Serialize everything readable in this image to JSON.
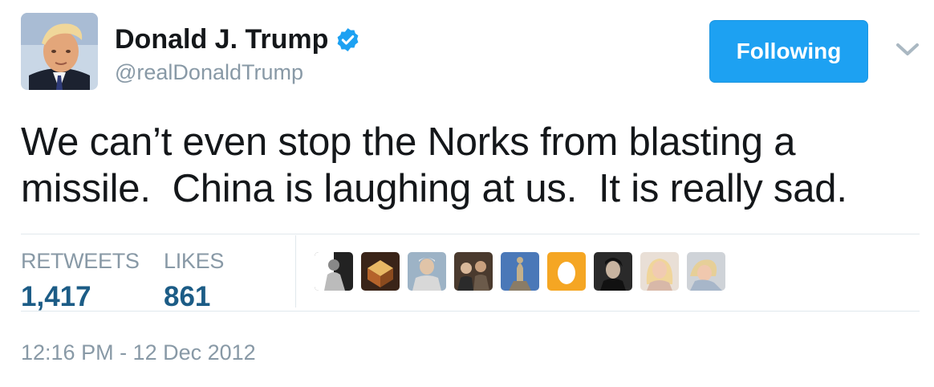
{
  "user": {
    "display_name": "Donald J. Trump",
    "handle": "@realDonaldTrump",
    "verified": true
  },
  "follow_button": {
    "label": "Following"
  },
  "tweet": {
    "text": "We can’t even stop the Norks from blasting a\nmissile.  China is laughing at us.  It is really sad."
  },
  "stats": {
    "retweets_label": "RETWEETS",
    "retweets_value": "1,417",
    "likes_label": "LIKES",
    "likes_value": "861"
  },
  "likers": [
    {
      "icon": "statue-portrait"
    },
    {
      "icon": "lamp-portrait"
    },
    {
      "icon": "man-portrait"
    },
    {
      "icon": "group-portrait"
    },
    {
      "icon": "statue-blue-portrait"
    },
    {
      "icon": "default-egg-avatar"
    },
    {
      "icon": "dark-portrait"
    },
    {
      "icon": "blonde-woman-portrait"
    },
    {
      "icon": "woman-portrait"
    }
  ],
  "timestamp": "12:16 PM - 12 Dec 2012",
  "colors": {
    "accent": "#1da1f2",
    "stat_value": "#1c5c86",
    "muted": "#8899a6"
  }
}
